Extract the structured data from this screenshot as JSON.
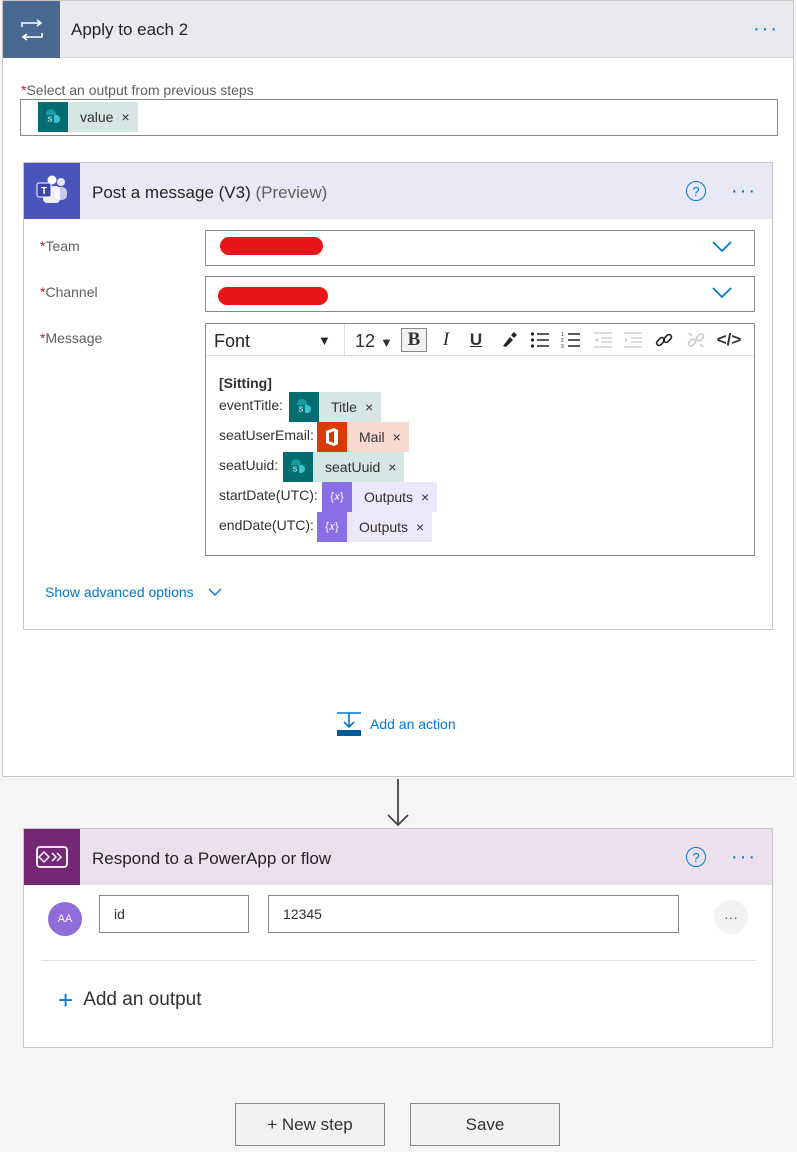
{
  "apply_to_each": {
    "title": "Apply to each 2",
    "more_label": "···",
    "select_label": "Select an output from previous steps",
    "required_mark": "*",
    "output_token": {
      "label": "value",
      "remove": "×",
      "icon": "sharepoint-icon"
    }
  },
  "post_message": {
    "title": "Post a message (V3)",
    "preview": "(Preview)",
    "help_label": "?",
    "more_label": "···",
    "fields": {
      "team_label": "Team",
      "channel_label": "Channel",
      "message_label": "Message"
    },
    "toolbar": {
      "font": "Font",
      "font_caret": "▼",
      "size": "12",
      "size_caret": "▼",
      "bold": "B",
      "italic": "I",
      "underline": "U",
      "code": "</>"
    },
    "message": {
      "heading": "[Sitting]",
      "lines": [
        {
          "label": "eventTitle:",
          "token": "Title",
          "kind": "sharepoint"
        },
        {
          "label": "seatUserEmail:",
          "token": "Mail",
          "kind": "office"
        },
        {
          "label": "seatUuid:",
          "token": "seatUuid",
          "kind": "sharepoint"
        },
        {
          "label": "startDate(UTC):",
          "token": "Outputs",
          "kind": "expression"
        },
        {
          "label": "endDate(UTC):",
          "token": "Outputs",
          "kind": "expression"
        }
      ],
      "remove": "×",
      "expr_icon_text": "{𝑥}"
    },
    "show_advanced": "Show advanced options"
  },
  "add_action": {
    "label": "Add an action"
  },
  "respond": {
    "title": "Respond to a PowerApp or flow",
    "help_label": "?",
    "more_label": "···",
    "avatar_text": "AA",
    "output_name": "id",
    "output_value": "12345",
    "row_more": "···",
    "add_output_plus": "+",
    "add_output": "Add an output"
  },
  "footer": {
    "new_step": "+ New step",
    "save": "Save"
  },
  "colors": {
    "accent": "#0078d4",
    "apply_header": "#486991",
    "teams": "#4b53bc",
    "powerapps": "#742774",
    "sharepoint": "#036c70",
    "office": "#d83b01",
    "expression": "#8a6ee6"
  }
}
